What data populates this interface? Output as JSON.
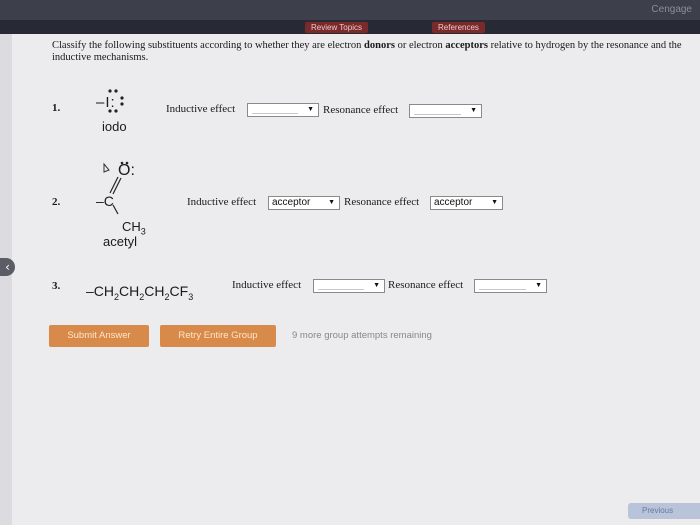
{
  "header": {
    "brand_fragment": "Cengage",
    "tabs": [
      {
        "label": "Review Topics"
      },
      {
        "label": "References"
      }
    ]
  },
  "instructions": {
    "prefix": "Classify the following substituents according to whether they are electron ",
    "donors": "donors",
    "middle": " or electron ",
    "acceptors": "acceptors",
    "suffix": " relative to hydrogen by the resonance and the inductive mechanisms."
  },
  "questions": [
    {
      "number": "1.",
      "structure": "–I:",
      "name": "iodo",
      "inductive_label": "Inductive effect",
      "inductive_value": "",
      "resonance_label": "Resonance effect",
      "resonance_value": ""
    },
    {
      "number": "2.",
      "structure_top": "O:",
      "structure_mid": "–C",
      "structure_bottom": "CH3",
      "name": "acetyl",
      "inductive_label": "Inductive effect",
      "inductive_value": "acceptor",
      "resonance_label": "Resonance effect",
      "resonance_value": "acceptor"
    },
    {
      "number": "3.",
      "structure": "–CH2CH2CH2CF3",
      "inductive_label": "Inductive effect",
      "inductive_value": "",
      "resonance_label": "Resonance effect",
      "resonance_value": ""
    }
  ],
  "actions": {
    "submit_label": "Submit Answer",
    "retry_label": "Retry Entire Group",
    "attempts_text": "9 more group attempts remaining"
  },
  "footer": {
    "previous_label": "Previous"
  },
  "colors": {
    "submit_bg": "#d88a4a",
    "retry_bg": "#d88a4a",
    "tab_bg": "#7a2a2a"
  },
  "icons": {
    "dropdown": "triangle-down-icon",
    "side_nav": "chevron-left-icon"
  }
}
